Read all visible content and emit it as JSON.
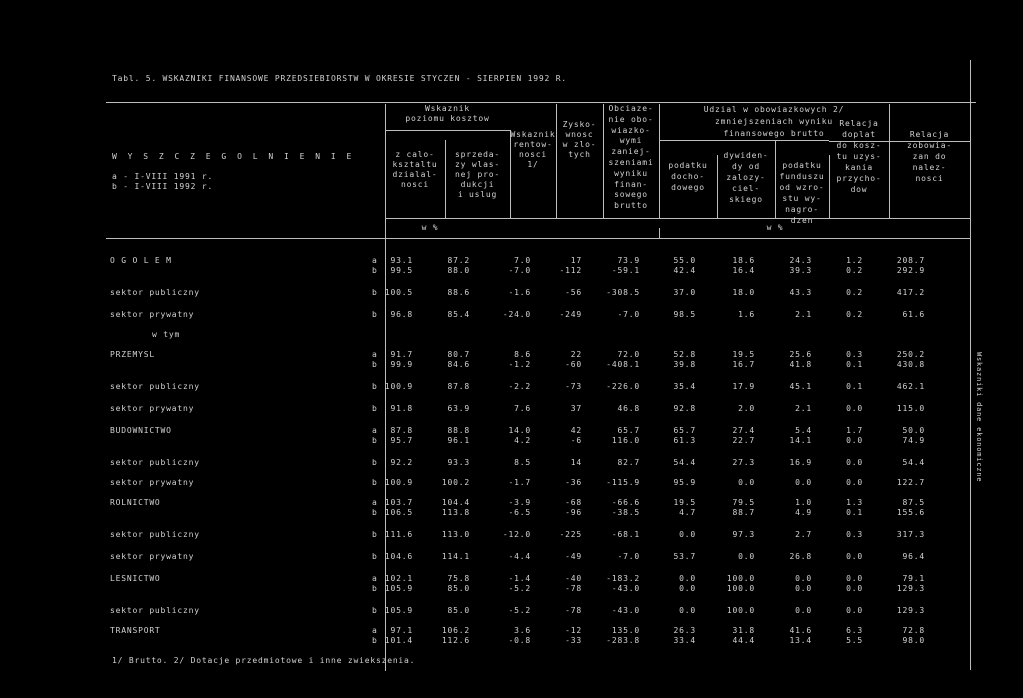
{
  "title": "Tabl. 5.  WSKAZNIKI FINANSOWE PRZEDSIEBIORSTW W OKRESIE STYCZEN - SIERPIEN 1992 R.",
  "side_note": "Wskazniki dane ekonomiczne",
  "stub": {
    "line1": "W Y S Z C Z E G O L N I E N I E",
    "line2": "a - I-VIII 1991 r.",
    "line3": "b - I-VIII 1992 r."
  },
  "head": {
    "wk_title": [
      "Wskaznik",
      "poziomu kosztow"
    ],
    "wk_calo": [
      "z calo-",
      "ksztaltu",
      "dzialal-",
      "nosci"
    ],
    "wk_sprzed": [
      "sprzeda-",
      "zy wlas-",
      "nej pro-",
      "dukcji",
      "i uslug"
    ],
    "rentow": [
      "Wskaznik",
      "rentow-",
      "nosci",
      "1/"
    ],
    "zysko": [
      "Zysko-",
      "wnosc",
      "w zlo-",
      "tych"
    ],
    "obciaz": [
      "Obciaze-",
      "nie obo-",
      "wiazko-",
      "wymi",
      "zaniej-",
      "szeniami",
      "wyniku",
      "finan-",
      "sowego",
      "brutto"
    ],
    "udzial": [
      "Udzial w obowiazkowych      2/",
      "zmniejszeniach wyniku",
      "finansowego brutto"
    ],
    "podatku_doch": [
      "podatku",
      "docho-",
      "dowego"
    ],
    "dywidend": [
      "dywiden-",
      "dy od",
      "zalozy-",
      "ciel-",
      "skiego"
    ],
    "fundusz": [
      "podatku",
      "od wzro-",
      "stu wy-",
      "nagro-",
      "dzen"
    ],
    "fundusz_f": [
      "funduszu"
    ],
    "relacja1": [
      "Relacja",
      "doplat",
      "do kosz-",
      "tu uzys-",
      "kania",
      "przycho-",
      "dow"
    ],
    "relacja2": [
      "Relacja",
      "zobowia-",
      "zan do",
      "nalez-",
      "nosci"
    ],
    "unit1": "w %",
    "unit2": "w %"
  },
  "rows": [
    {
      "label": "O G O L E M",
      "ab": "a",
      "v": [
        "93.1",
        "87.2",
        "7.0",
        "17",
        "73.9",
        "55.0",
        "18.6",
        "24.3",
        "1.2",
        "208.7"
      ]
    },
    {
      "label": "",
      "ab": "b",
      "v": [
        "99.5",
        "88.0",
        "-7.0",
        "-112",
        "-59.1",
        "42.4",
        "16.4",
        "39.3",
        "0.2",
        "292.9"
      ]
    },
    {
      "label": "sektor publiczny",
      "ab": "b",
      "v": [
        "100.5",
        "88.6",
        "-1.6",
        "-56",
        "-308.5",
        "37.0",
        "18.0",
        "43.3",
        "0.2",
        "417.2"
      ]
    },
    {
      "label": "sektor prywatny",
      "ab": "b",
      "v": [
        "96.8",
        "85.4",
        "-24.0",
        "-249",
        "-7.0",
        "98.5",
        "1.6",
        "2.1",
        "0.2",
        "61.6"
      ]
    },
    {
      "label": "w tym",
      "ab": "",
      "v": [
        "",
        "",
        "",
        "",
        "",
        "",
        "",
        "",
        "",
        ""
      ]
    },
    {
      "label": "PRZEMYSL",
      "ab": "a",
      "v": [
        "91.7",
        "80.7",
        "8.6",
        "22",
        "72.0",
        "52.8",
        "19.5",
        "25.6",
        "0.3",
        "250.2"
      ]
    },
    {
      "label": "",
      "ab": "b",
      "v": [
        "99.9",
        "84.6",
        "-1.2",
        "-60",
        "-408.1",
        "39.8",
        "16.7",
        "41.8",
        "0.1",
        "430.8"
      ]
    },
    {
      "label": "sektor publiczny",
      "ab": "b",
      "v": [
        "100.9",
        "87.8",
        "-2.2",
        "-73",
        "-226.0",
        "35.4",
        "17.9",
        "45.1",
        "0.1",
        "462.1"
      ]
    },
    {
      "label": "sektor prywatny",
      "ab": "b",
      "v": [
        "91.8",
        "63.9",
        "7.6",
        "37",
        "46.8",
        "92.8",
        "2.0",
        "2.1",
        "0.0",
        "115.0"
      ]
    },
    {
      "label": "BUDOWNICTWO",
      "ab": "a",
      "v": [
        "87.8",
        "88.8",
        "14.0",
        "42",
        "65.7",
        "65.7",
        "27.4",
        "5.4",
        "1.7",
        "50.0"
      ]
    },
    {
      "label": "",
      "ab": "b",
      "v": [
        "95.7",
        "96.1",
        "4.2",
        "-6",
        "116.0",
        "61.3",
        "22.7",
        "14.1",
        "0.0",
        "74.9"
      ]
    },
    {
      "label": "sektor publiczny",
      "ab": "b",
      "v": [
        "92.2",
        "93.3",
        "8.5",
        "14",
        "82.7",
        "54.4",
        "27.3",
        "16.9",
        "0.0",
        "54.4"
      ]
    },
    {
      "label": "sektor prywatny",
      "ab": "b",
      "v": [
        "100.9",
        "100.2",
        "-1.7",
        "-36",
        "-115.9",
        "95.9",
        "0.0",
        "0.0",
        "0.0",
        "122.7"
      ]
    },
    {
      "label": "ROLNICTWO",
      "ab": "a",
      "v": [
        "103.7",
        "104.4",
        "-3.9",
        "-68",
        "-66.6",
        "19.5",
        "79.5",
        "1.0",
        "1.3",
        "87.5"
      ]
    },
    {
      "label": "",
      "ab": "b",
      "v": [
        "106.5",
        "113.8",
        "-6.5",
        "-96",
        "-38.5",
        "4.7",
        "88.7",
        "4.9",
        "0.1",
        "155.6"
      ]
    },
    {
      "label": "sektor publiczny",
      "ab": "b",
      "v": [
        "111.6",
        "113.0",
        "-12.0",
        "-225",
        "-68.1",
        "0.0",
        "97.3",
        "2.7",
        "0.3",
        "317.3"
      ]
    },
    {
      "label": "sektor prywatny",
      "ab": "b",
      "v": [
        "104.6",
        "114.1",
        "-4.4",
        "-49",
        "-7.0",
        "53.7",
        "0.0",
        "26.8",
        "0.0",
        "96.4"
      ]
    },
    {
      "label": "LESNICTWO",
      "ab": "a",
      "v": [
        "102.1",
        "75.8",
        "-1.4",
        "-40",
        "-183.2",
        "0.0",
        "100.0",
        "0.0",
        "0.0",
        "79.1"
      ]
    },
    {
      "label": "",
      "ab": "b",
      "v": [
        "105.9",
        "85.0",
        "-5.2",
        "-78",
        "-43.0",
        "0.0",
        "100.0",
        "0.0",
        "0.0",
        "129.3"
      ]
    },
    {
      "label": "sektor publiczny",
      "ab": "b",
      "v": [
        "105.9",
        "85.0",
        "-5.2",
        "-78",
        "-43.0",
        "0.0",
        "100.0",
        "0.0",
        "0.0",
        "129.3"
      ]
    },
    {
      "label": "TRANSPORT",
      "ab": "a",
      "v": [
        "97.1",
        "106.2",
        "3.6",
        "-12",
        "135.0",
        "26.3",
        "31.8",
        "41.6",
        "6.3",
        "72.8"
      ]
    },
    {
      "label": "",
      "ab": "b",
      "v": [
        "101.4",
        "112.6",
        "-0.8",
        "-33",
        "-283.8",
        "33.4",
        "44.4",
        "13.4",
        "5.5",
        "98.0"
      ]
    }
  ],
  "footnote": "1/ Brutto.   2/ Dotacje przedmiotowe i inne zwiekszenia."
}
